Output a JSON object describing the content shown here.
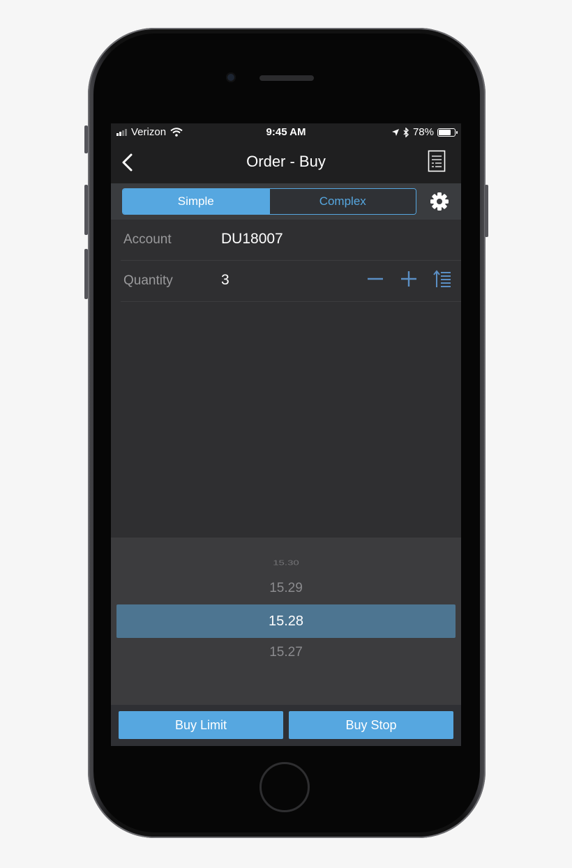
{
  "status_bar": {
    "carrier": "Verizon",
    "time": "9:45 AM",
    "battery": "78%",
    "battery_level": 0.78
  },
  "nav": {
    "title": "Order - Buy",
    "back_icon": "chevron-left-icon",
    "orders_icon": "document-list-icon"
  },
  "mode": {
    "tabs": [
      {
        "label": "Simple",
        "active": true
      },
      {
        "label": "Complex",
        "active": false
      }
    ],
    "settings_icon": "gear-icon"
  },
  "form": {
    "account": {
      "label": "Account",
      "value": "DU18007"
    },
    "quantity": {
      "label": "Quantity",
      "value": "3"
    }
  },
  "price_picker": {
    "items": [
      "15.30",
      "15.29",
      "15.28",
      "15.27"
    ],
    "selected": "15.28"
  },
  "actions": {
    "buy_limit": "Buy Limit",
    "buy_stop": "Buy Stop"
  },
  "colors": {
    "accent": "#56a7e0",
    "selected_row": "#4d7591",
    "background": "#2f2f31"
  }
}
